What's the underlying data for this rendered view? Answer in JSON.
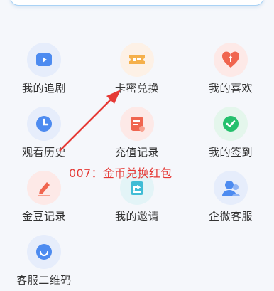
{
  "items": [
    {
      "label": "我的追剧",
      "icon": "play-video-icon",
      "bg": "#e6edfb",
      "color": "#4d8bf0"
    },
    {
      "label": "卡密兑换",
      "icon": "ticket-icon",
      "bg": "#fdf1e6",
      "color": "#f5b04b"
    },
    {
      "label": "我的喜欢",
      "icon": "heart-icon",
      "bg": "#fde9e7",
      "color": "#f0654f"
    },
    {
      "label": "观看历史",
      "icon": "clock-icon",
      "bg": "#e6edfb",
      "color": "#4d8bf0"
    },
    {
      "label": "充值记录",
      "icon": "recharge-record-icon",
      "bg": "#fde9e7",
      "color": "#f0654f"
    },
    {
      "label": "我的签到",
      "icon": "checkin-icon",
      "bg": "#e4f6ec",
      "color": "#25c06d"
    },
    {
      "label": "金豆记录",
      "icon": "pen-record-icon",
      "bg": "#fde9e7",
      "color": "#f0654f"
    },
    {
      "label": "我的邀请",
      "icon": "share-invite-icon",
      "bg": "#e3f4f7",
      "color": "#3fbcd5"
    },
    {
      "label": "企微客服",
      "icon": "wecom-service-icon",
      "bg": "#e6edfb",
      "color": "#4d8bf0"
    },
    {
      "label": "客服二维码",
      "icon": "service-qrcode-icon",
      "bg": "#e6edfb",
      "color": "#4d8bf0"
    }
  ],
  "annotation": {
    "text": "007：金币兑换红包",
    "color": "#e53935"
  }
}
